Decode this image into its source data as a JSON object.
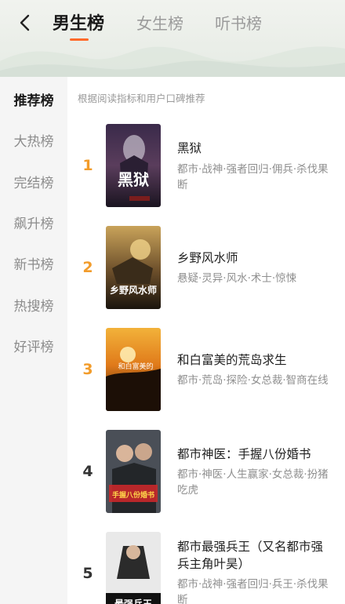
{
  "header": {
    "tabs": [
      {
        "label": "男生榜",
        "active": true
      },
      {
        "label": "女生榜",
        "active": false
      },
      {
        "label": "听书榜",
        "active": false
      }
    ]
  },
  "sidebar": {
    "items": [
      {
        "label": "推荐榜",
        "active": true
      },
      {
        "label": "大热榜"
      },
      {
        "label": "完结榜"
      },
      {
        "label": "飙升榜"
      },
      {
        "label": "新书榜"
      },
      {
        "label": "热搜榜"
      },
      {
        "label": "好评榜"
      }
    ]
  },
  "content": {
    "subtitle": "根据阅读指标和用户口碑推荐",
    "books": [
      {
        "rank": "1",
        "title": "黑狱",
        "tags": "都市·战神·强者回归·佣兵·杀伐果断",
        "cover_text": "黑狱"
      },
      {
        "rank": "2",
        "title": "乡野风水师",
        "tags": "悬疑·灵异·风水·术士·惊悚",
        "cover_text": "乡野风水师"
      },
      {
        "rank": "3",
        "title": "和白富美的荒岛求生",
        "tags": "都市·荒岛·探险·女总裁·智商在线",
        "cover_text": "和白富美的"
      },
      {
        "rank": "4",
        "title": "都市神医：手握八份婚书",
        "tags": "都市·神医·人生赢家·女总裁·扮猪吃虎",
        "cover_text": "手握八份婚书"
      },
      {
        "rank": "5",
        "title": "都市最强兵王（又名都市强兵主角叶昊）",
        "tags": "都市·战神·强者回归·兵王·杀伐果断",
        "cover_text": "最强兵王"
      }
    ]
  },
  "colors": {
    "accent": "#ff6a2a",
    "rank_top": "#f29c2b",
    "sidebar_bg": "#f5f5f5"
  }
}
